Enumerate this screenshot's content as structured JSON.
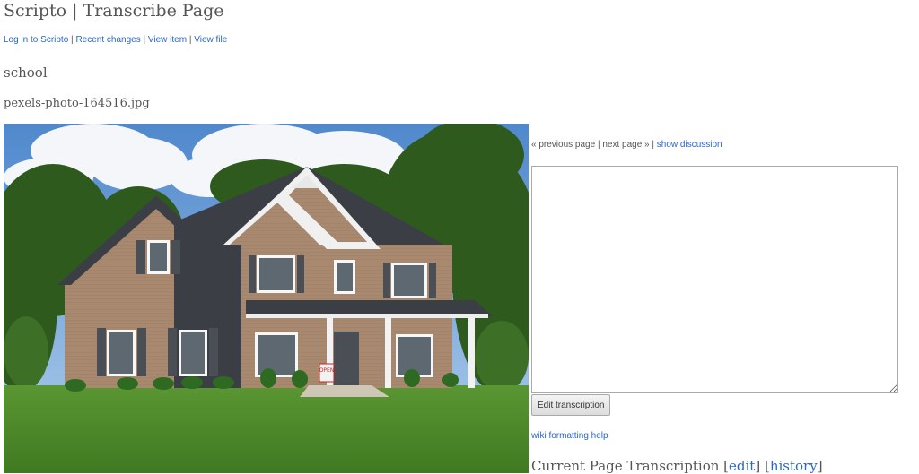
{
  "header": {
    "title": "Scripto | Transcribe Page"
  },
  "nav": {
    "login": "Log in to Scripto",
    "recent": "Recent changes",
    "view_item": "View item",
    "view_file": "View file",
    "separator": "|"
  },
  "item": {
    "title": "school",
    "file_name": "pexels-photo-164516.jpg"
  },
  "pager": {
    "previous": "« previous page",
    "separator": "|",
    "next": "next page »",
    "separator2": "|",
    "show_discussion": "show discussion"
  },
  "transcription": {
    "value": "",
    "edit_button": "Edit transcription",
    "wiki_help": "wiki formatting help"
  },
  "current": {
    "heading": "Current Page Transcription",
    "edit_open": "[",
    "edit": "edit",
    "edit_close": "]",
    "history_open": "[",
    "history": "history",
    "history_close": "]"
  },
  "photo": {
    "sign_text": "OPEN"
  },
  "colors": {
    "link": "#2a66cc",
    "text": "#555555",
    "sky": "#5f97d4",
    "lawn": "#4f8a2b",
    "brick": "#a7886e"
  }
}
